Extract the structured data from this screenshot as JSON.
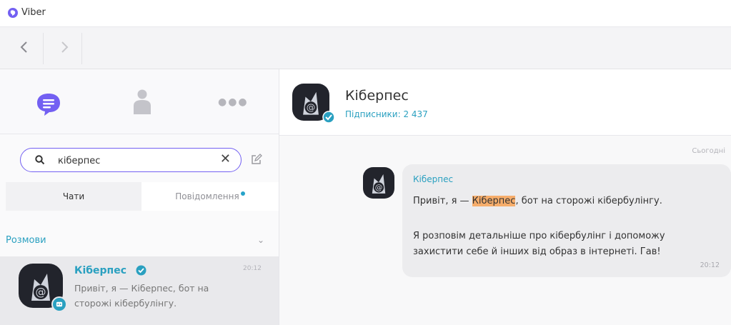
{
  "window": {
    "title": "Viber",
    "brand_color": "#7360f2"
  },
  "nav": {
    "back_icon": "chevron-left-icon",
    "forward_icon": "chevron-right-icon"
  },
  "sidebar": {
    "icons": [
      "chats-icon",
      "contacts-icon",
      "more-icon"
    ],
    "search": {
      "value": "кіберпес",
      "clear_label": "✕"
    },
    "tabs": [
      {
        "label": "Чати",
        "active": true
      },
      {
        "label": "Повідомлення",
        "active": false,
        "has_dot": true
      }
    ],
    "section_title": "Розмови",
    "conversations": [
      {
        "name": "Кіберпес",
        "time": "20:12",
        "preview": "Привіт, я — Кіберпес, бот на сторожі кібербулінгу.",
        "verified": true,
        "bot": true
      }
    ]
  },
  "header": {
    "name": "Кіберпес",
    "subscribers": "Підписники: 2 437"
  },
  "chat": {
    "date": "Сьогодні",
    "message": {
      "from": "Кіберпес",
      "line1_before": "Привіт, я — ",
      "line1_highlight": "Кіберпес",
      "line1_after": ", бот на сторожі кібербулінгу.",
      "line2": "Я розповім детальніше про кібербулінг і допоможу захистити себе й інших від образ в інтернеті. Гав!",
      "time": "20:12"
    }
  },
  "colors": {
    "accent": "#7360f2",
    "teal": "#2aa0c0",
    "highlight": "#f6ad6b"
  }
}
